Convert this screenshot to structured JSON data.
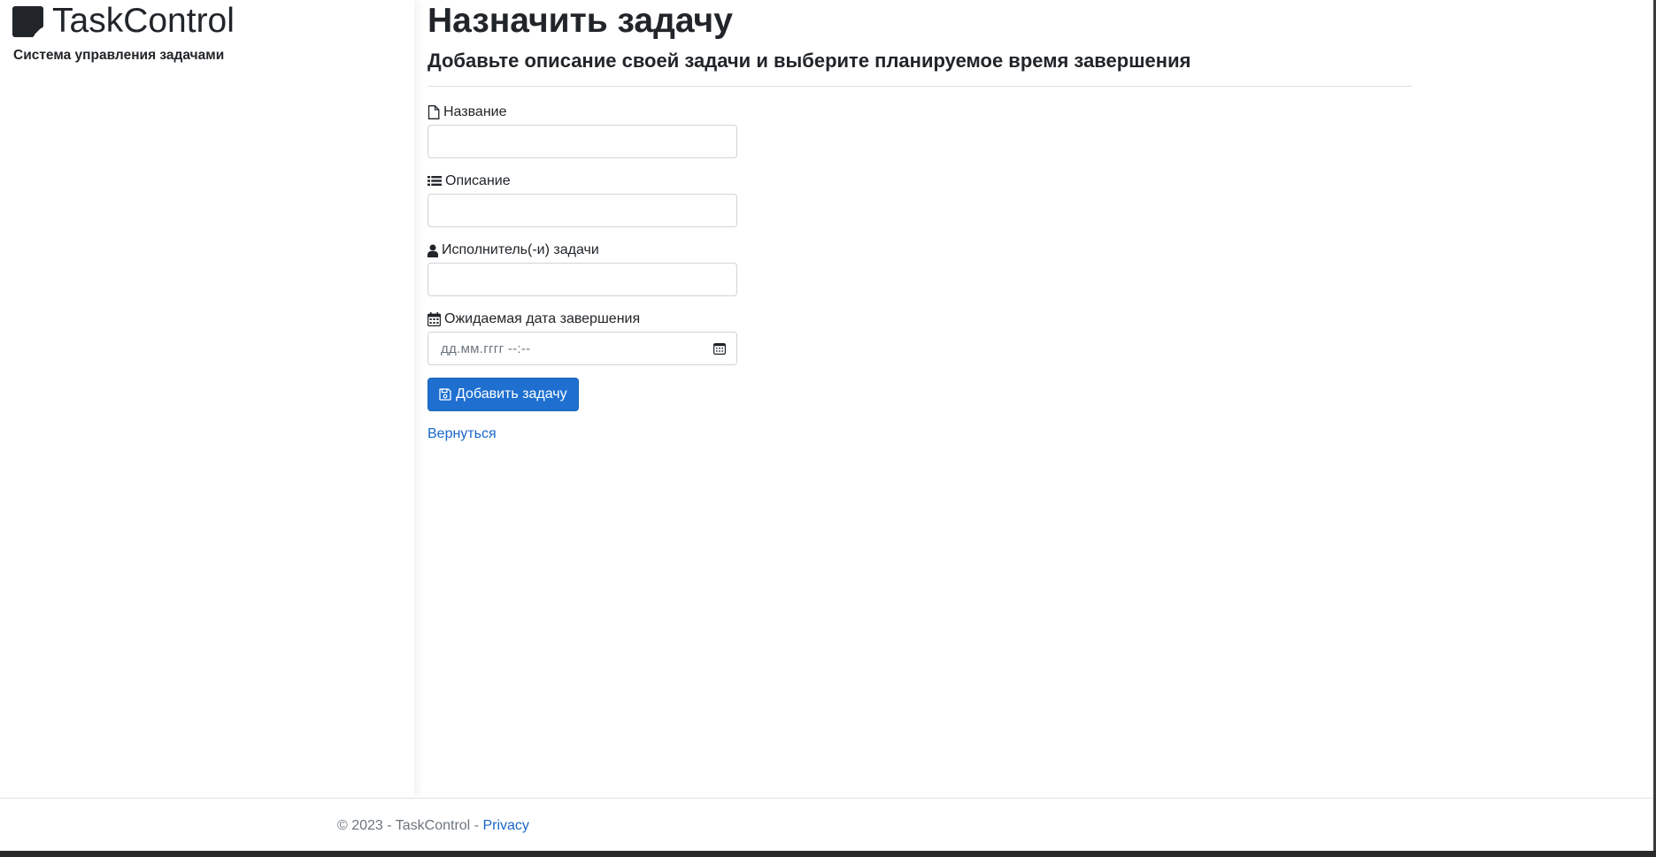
{
  "brand": {
    "name": "TaskControl",
    "tagline": "Система управления задачами"
  },
  "page": {
    "title": "Назначить задачу",
    "subtitle": "Добавьте описание своей задачи и выберите планируемое время завершения"
  },
  "form": {
    "fields": [
      {
        "label": "Название",
        "icon": "file-icon",
        "value": ""
      },
      {
        "label": "Описание",
        "icon": "list-icon",
        "value": ""
      },
      {
        "label": "Исполнитель(-и) задачи",
        "icon": "user-icon",
        "value": ""
      },
      {
        "label": "Ожидаемая дата завершения",
        "icon": "calendar-icon",
        "placeholder": "дд.мм.гггг --:--"
      }
    ],
    "submit_label": "Добавить задачу",
    "back_label": "Вернуться"
  },
  "footer": {
    "copyright": "© 2023 - TaskControl - ",
    "privacy_label": "Privacy"
  },
  "colors": {
    "primary": "#1e6fd0",
    "link": "#1a66c9",
    "text": "#212529",
    "muted": "#6c757d"
  }
}
